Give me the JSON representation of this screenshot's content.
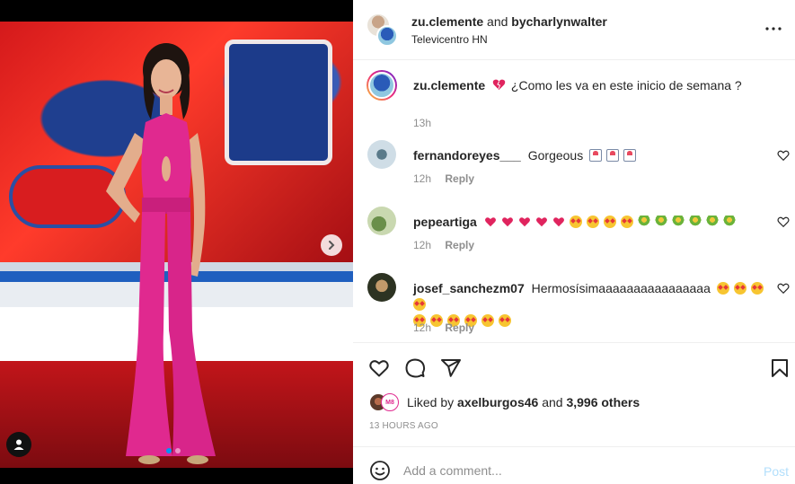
{
  "post": {
    "author": "zu.clemente",
    "and_text": "and",
    "collaborator": "bycharlynwalter",
    "location": "Televicentro HN"
  },
  "caption": {
    "user": "zu.clemente",
    "text": "¿Como les va en este inicio de semana ?",
    "time": "13h"
  },
  "comments": [
    {
      "user": "fernandoreyes___",
      "text": "Gorgeous",
      "emojis": [
        "mail",
        "mail",
        "mail"
      ],
      "time": "12h",
      "reply": "Reply"
    },
    {
      "user": "pepeartiga",
      "text": "",
      "emojis": [
        "heart",
        "heart",
        "heart",
        "heart",
        "heart",
        "starry",
        "starry",
        "starry",
        "starry",
        "bouquet",
        "bouquet",
        "bouquet",
        "bouquet",
        "bouquet",
        "bouquet"
      ],
      "time": "12h",
      "reply": "Reply"
    },
    {
      "user": "josef_sanchezm07",
      "text": "Hermosísimaaaaaaaaaaaaaaaa",
      "emojis_line1": [
        "starry",
        "starry",
        "starry",
        "starry"
      ],
      "emojis_line2": [
        "starry",
        "starry",
        "starry",
        "starry",
        "starry",
        "starry"
      ],
      "time": "12h",
      "reply": "Reply"
    }
  ],
  "likes": {
    "prefix": "Liked by",
    "user": "axelburgos46",
    "and": "and",
    "others": "3,996 others",
    "avatar_badge": "M8"
  },
  "timestamp": "13 hours ago",
  "add_comment": {
    "placeholder": "Add a comment...",
    "post_label": "Post"
  },
  "colors": {
    "heart": "#e0245e",
    "link_blue": "#0095f6",
    "post_disabled": "#b2dffc",
    "jumpsuit": "#e0298f"
  },
  "icons": {
    "more": "more-horizontal-icon",
    "like": "heart-outline-icon",
    "comment": "speech-bubble-icon",
    "share": "paper-plane-icon",
    "save": "bookmark-icon",
    "emoji": "smiley-icon",
    "next": "chevron-right-icon",
    "tag": "user-tag-icon"
  }
}
